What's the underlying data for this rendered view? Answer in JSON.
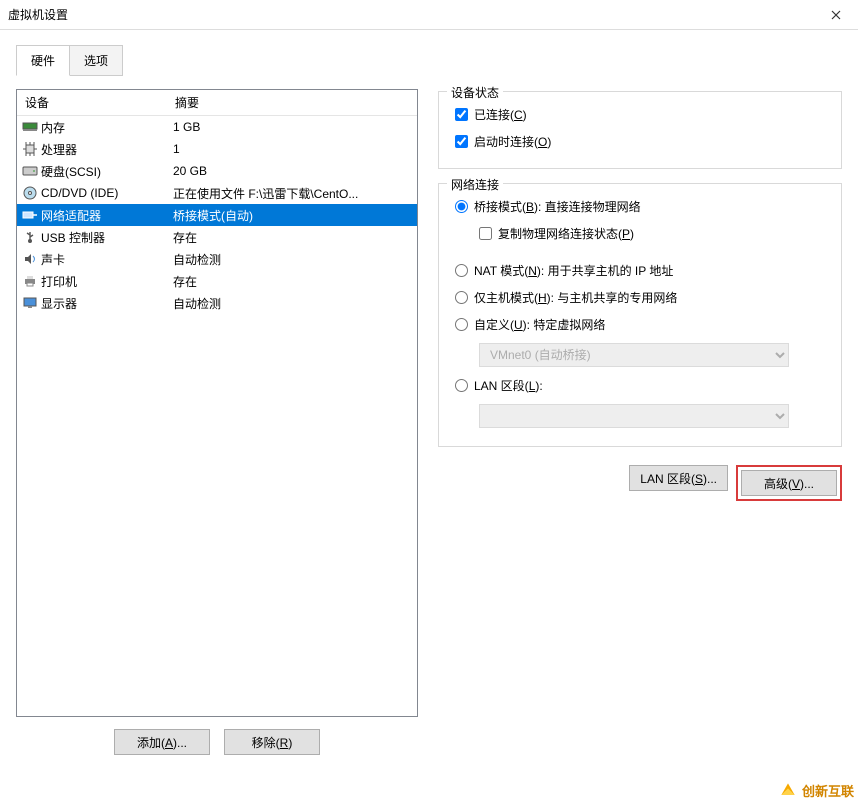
{
  "title": "虚拟机设置",
  "tabs": {
    "hardware": "硬件",
    "options": "选项"
  },
  "columns": {
    "device": "设备",
    "summary": "摘要"
  },
  "devices": [
    {
      "icon": "memory",
      "name": "内存",
      "summary": "1 GB"
    },
    {
      "icon": "cpu",
      "name": "处理器",
      "summary": "1"
    },
    {
      "icon": "disk",
      "name": "硬盘(SCSI)",
      "summary": "20 GB"
    },
    {
      "icon": "cd",
      "name": "CD/DVD (IDE)",
      "summary": "正在使用文件 F:\\迅雷下载\\CentO..."
    },
    {
      "icon": "net",
      "name": "网络适配器",
      "summary": "桥接模式(自动)"
    },
    {
      "icon": "usb",
      "name": "USB 控制器",
      "summary": "存在"
    },
    {
      "icon": "sound",
      "name": "声卡",
      "summary": "自动检测"
    },
    {
      "icon": "printer",
      "name": "打印机",
      "summary": "存在"
    },
    {
      "icon": "display",
      "name": "显示器",
      "summary": "自动检测"
    }
  ],
  "buttons": {
    "add": "添加(A)...",
    "remove": "移除(R)"
  },
  "status": {
    "legend": "设备状态",
    "connected_prefix": "已连接(",
    "connected_key": "C",
    "connected_suffix": ")",
    "connect_at_poweron_prefix": "启动时连接(",
    "connect_at_poweron_key": "O",
    "connect_at_poweron_suffix": ")"
  },
  "network": {
    "legend": "网络连接",
    "bridged_prefix": "桥接模式(",
    "bridged_key": "B",
    "bridged_suffix": "): 直接连接物理网络",
    "replicate_prefix": "复制物理网络连接状态(",
    "replicate_key": "P",
    "replicate_suffix": ")",
    "nat_prefix": "NAT 模式(",
    "nat_key": "N",
    "nat_suffix": "): 用于共享主机的 IP 地址",
    "hostonly_prefix": "仅主机模式(",
    "hostonly_key": "H",
    "hostonly_suffix": "): 与主机共享的专用网络",
    "custom_prefix": "自定义(",
    "custom_key": "U",
    "custom_suffix": "): 特定虚拟网络",
    "vmnet_value": "VMnet0 (自动桥接)",
    "lan_prefix": "LAN 区段(",
    "lan_key": "L",
    "lan_suffix": "):",
    "lan_segments_prefix": "LAN 区段(",
    "lan_segments_key": "S",
    "lan_segments_suffix": ")...",
    "advanced_prefix": "高级(",
    "advanced_key": "V",
    "advanced_suffix": ")..."
  },
  "watermark": "创新互联"
}
